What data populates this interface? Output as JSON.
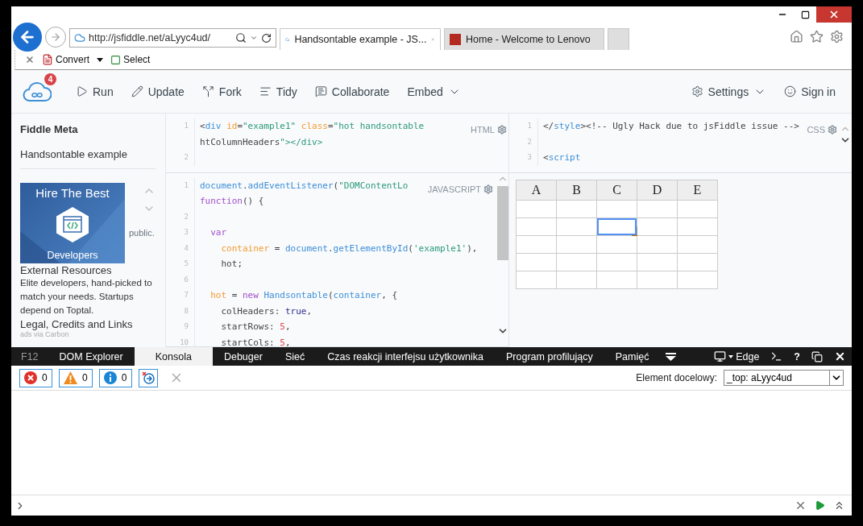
{
  "browser": {
    "address": {
      "url": "http://jsfiddle.net/aLyyc4ud/"
    },
    "tabs": [
      {
        "title": "Handsontable example - JS...",
        "selected": true,
        "closable": true
      },
      {
        "title": "Home - Welcome to Lenovo",
        "selected": false,
        "closable": false
      }
    ],
    "command_bar": [
      {
        "label": "Convert",
        "kind": "menu"
      },
      {
        "label": "Select",
        "kind": "plain"
      }
    ]
  },
  "toolbar": {
    "badge": "4",
    "actions": [
      {
        "label": "Run"
      },
      {
        "label": "Update"
      },
      {
        "label": "Fork"
      },
      {
        "label": "Tidy"
      },
      {
        "label": "Collaborate"
      }
    ],
    "embed": {
      "label": "Embed"
    },
    "settings": {
      "label": "Settings"
    },
    "sign_in": {
      "label": "Sign in"
    }
  },
  "sidebar": {
    "title": "Fiddle Meta",
    "fiddle_name": "Handsontable example",
    "visibility_note": "public.",
    "sections": [
      "External Resources",
      "Legal, Credits and Links"
    ],
    "ad": {
      "headline": "Hire The Best",
      "caption": "Developers",
      "text": "Elite developers, hand-picked to match your needs. Startups depend on Toptal.",
      "credit": "ads via Carbon"
    }
  },
  "editors": [
    {
      "label": "HTML",
      "lines": [
        {
          "number": "1",
          "rows": [
            "<div id=\"example1\" class=\"hot handsontable",
            "htColumnHeaders\"></div>"
          ]
        },
        {
          "number": "2"
        }
      ]
    },
    {
      "label": "JAVASCRIPT",
      "lines": [
        {
          "number": "1",
          "rows": [
            "document.addEventListener(\"DOMContentLo",
            "function() {"
          ]
        },
        {
          "number": "2"
        },
        {
          "number": "3",
          "rows": [
            "  var"
          ]
        },
        {
          "number": "4",
          "rows": [
            "    container = document.getElementById('example1'),"
          ]
        },
        {
          "number": "5",
          "rows": [
            "    hot;"
          ]
        },
        {
          "number": "6"
        },
        {
          "number": "7",
          "rows": [
            "  hot = new Handsontable(container, {"
          ]
        },
        {
          "number": "8",
          "rows": [
            "    colHeaders: true,"
          ]
        },
        {
          "number": "9",
          "rows": [
            "    startRows: 5,"
          ]
        },
        {
          "number": "10",
          "rows": [
            "    startCols: 5,"
          ]
        }
      ]
    },
    {
      "label": "CSS",
      "lines": [
        {
          "number": "1",
          "rows": [
            "</style><!-- Ugly Hack due to jsFiddle issue -->"
          ]
        },
        {
          "number": "2"
        },
        {
          "number": "3",
          "rows": [
            "<script"
          ]
        }
      ]
    }
  ],
  "result": {
    "columns": [
      {
        "label": "A"
      },
      {
        "label": "B"
      },
      {
        "label": "C"
      },
      {
        "label": "D"
      },
      {
        "label": "E"
      }
    ],
    "rows": [
      {
        "cells": [
          {
            "selected": false
          },
          {
            "selected": false
          },
          {
            "selected": false
          },
          {
            "selected": false
          },
          {
            "selected": false
          }
        ]
      },
      {
        "cells": [
          {
            "selected": false
          },
          {
            "selected": false
          },
          {
            "selected": true
          },
          {
            "selected": false
          },
          {
            "selected": false
          }
        ]
      },
      {
        "cells": [
          {
            "selected": false
          },
          {
            "selected": false
          },
          {
            "selected": false
          },
          {
            "selected": false
          },
          {
            "selected": false
          }
        ]
      },
      {
        "cells": [
          {
            "selected": false
          },
          {
            "selected": false
          },
          {
            "selected": false
          },
          {
            "selected": false
          },
          {
            "selected": false
          }
        ]
      },
      {
        "cells": [
          {
            "selected": false
          },
          {
            "selected": false
          },
          {
            "selected": false
          },
          {
            "selected": false
          },
          {
            "selected": false
          }
        ]
      }
    ]
  },
  "devtools": {
    "key": "F12",
    "tabs": [
      {
        "label": "DOM Explorer",
        "selected": false
      },
      {
        "label": "Konsola",
        "selected": true
      },
      {
        "label": "Debuger",
        "selected": false
      },
      {
        "label": "Sieć",
        "selected": false
      },
      {
        "label": "Czas reakcji interfejsu użytkownika",
        "selected": false
      },
      {
        "label": "Program profilujący",
        "selected": false
      },
      {
        "label": "Pamięć",
        "selected": false
      }
    ],
    "engine": "Edge",
    "help": "?",
    "counters": [
      {
        "count": "0"
      },
      {
        "count": "0"
      },
      {
        "count": "0"
      }
    ],
    "target_label": "Element docelowy:",
    "target_value": "_top: aLyyc4ud"
  }
}
